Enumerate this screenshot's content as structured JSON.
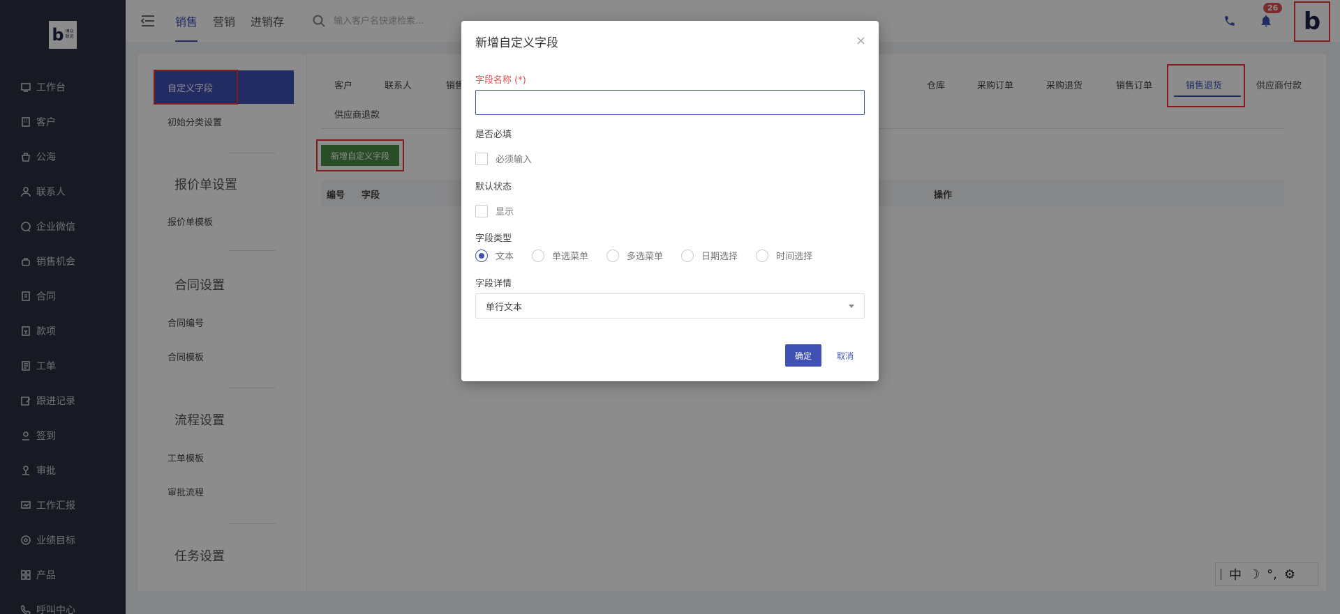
{
  "brand": {
    "logo_text_line1": "博众",
    "logo_text_line2": "致远"
  },
  "sidebar": {
    "items": [
      {
        "label": "工作台",
        "icon": "dashboard-icon"
      },
      {
        "label": "客户",
        "icon": "building-icon"
      },
      {
        "label": "公海",
        "icon": "pool-icon"
      },
      {
        "label": "联系人",
        "icon": "person-icon"
      },
      {
        "label": "企业微信",
        "icon": "chat-icon"
      },
      {
        "label": "销售机会",
        "icon": "bag-icon"
      },
      {
        "label": "合同",
        "icon": "contract-icon"
      },
      {
        "label": "款项",
        "icon": "payment-icon"
      },
      {
        "label": "工单",
        "icon": "ticket-icon"
      },
      {
        "label": "跟进记录",
        "icon": "edit-icon"
      },
      {
        "label": "签到",
        "icon": "location-icon"
      },
      {
        "label": "审批",
        "icon": "approval-icon"
      },
      {
        "label": "工作汇报",
        "icon": "report-icon"
      },
      {
        "label": "业绩目标",
        "icon": "target-icon"
      },
      {
        "label": "产品",
        "icon": "grid-icon"
      },
      {
        "label": "呼叫中心",
        "icon": "phone-icon"
      }
    ]
  },
  "topbar": {
    "tabs": [
      "销售",
      "营销",
      "进销存"
    ],
    "active_tab": "销售",
    "search_placeholder": "输入客户名快速检索...",
    "notification_count": "26",
    "brand_letter": "b"
  },
  "left_panel": {
    "active_item": "自定义字段",
    "item_initial": "初始分类设置",
    "section_quote": "报价单设置",
    "item_quote_template": "报价单模板",
    "section_contract": "合同设置",
    "item_contract_number": "合同编号",
    "item_contract_template": "合同模板",
    "section_process": "流程设置",
    "item_ticket_template": "工单模板",
    "item_approval_flow": "审批流程",
    "section_task": "任务设置"
  },
  "entity_tabs": {
    "row1": [
      "客户",
      "联系人",
      "销售",
      "仓库",
      "采购订单",
      "采购退货",
      "销售订单",
      "销售退货",
      "供应商付款"
    ],
    "row2": [
      "供应商退款"
    ],
    "active": "销售退货"
  },
  "main": {
    "add_button": "新增自定义字段",
    "columns": [
      "编号",
      "字段",
      "操作"
    ]
  },
  "modal": {
    "title": "新增自定义字段",
    "close": "×",
    "field_name_label": "字段名称 (*)",
    "field_name_value": "",
    "required_label": "是否必填",
    "required_checkbox": "必须输入",
    "default_label": "默认状态",
    "default_checkbox": "显示",
    "type_label": "字段类型",
    "types": [
      "文本",
      "单选菜单",
      "多选菜单",
      "日期选择",
      "时间选择"
    ],
    "selected_type": "文本",
    "detail_label": "字段详情",
    "detail_value": "单行文本",
    "ok": "确定",
    "cancel": "取消"
  },
  "ime": {
    "mode": "中",
    "moon": "☽",
    "punct": "°,",
    "gear": "⚙"
  }
}
